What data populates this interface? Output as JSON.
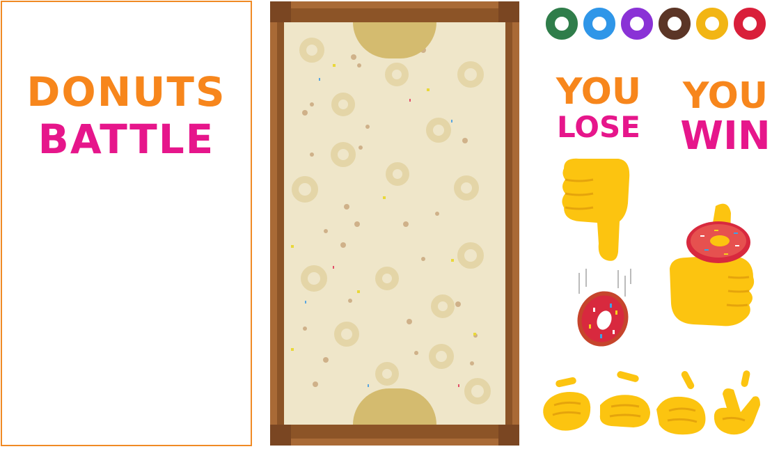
{
  "title": {
    "line1": "DONUTS",
    "line2": "BATTLE"
  },
  "colors": {
    "orange": "#f7861c",
    "pink": "#e6168b",
    "board_wood": "#a96a36",
    "field": "#efe6c9",
    "goal": "#d4bb6f",
    "hand_yellow": "#fcc410"
  },
  "donut_selector": [
    {
      "icon": "green-donut-icon",
      "color": "#2f7d4a"
    },
    {
      "icon": "blue-checkered-donut-icon",
      "color": "#2f96e8"
    },
    {
      "icon": "purple-donut-icon",
      "color": "#8a32d6"
    },
    {
      "icon": "chocolate-sprinkle-donut-icon",
      "color": "#5b3526"
    },
    {
      "icon": "yellow-donut-icon",
      "color": "#f2b514"
    },
    {
      "icon": "red-donut-icon",
      "color": "#d91f3a"
    }
  ],
  "results": {
    "lose": {
      "line1": "YOU",
      "line2": "LOSE",
      "icon": "thumbs-down-icon"
    },
    "win": {
      "line1": "YOU",
      "line2": "WIN",
      "icon": "thumbs-up-donut-icon"
    }
  },
  "hands": [
    "hand-rock-icon",
    "hand-paper-icon",
    "hand-spread-icon",
    "hand-victory-icon"
  ]
}
